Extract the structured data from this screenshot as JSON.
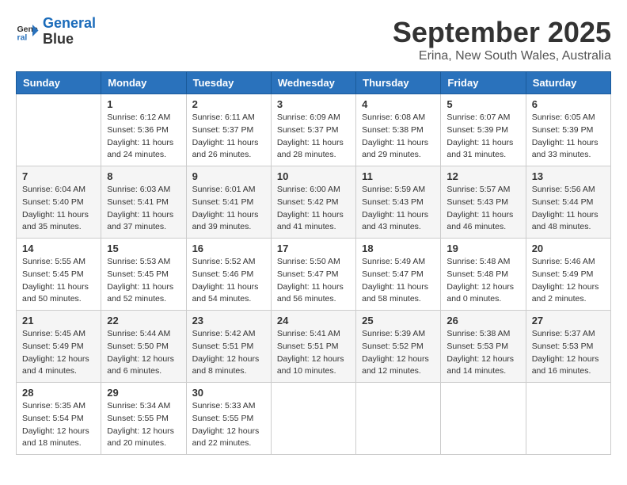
{
  "logo": {
    "line1": "General",
    "line2": "Blue"
  },
  "title": "September 2025",
  "location": "Erina, New South Wales, Australia",
  "days_header": [
    "Sunday",
    "Monday",
    "Tuesday",
    "Wednesday",
    "Thursday",
    "Friday",
    "Saturday"
  ],
  "weeks": [
    [
      {
        "day": "",
        "info": ""
      },
      {
        "day": "1",
        "info": "Sunrise: 6:12 AM\nSunset: 5:36 PM\nDaylight: 11 hours\nand 24 minutes."
      },
      {
        "day": "2",
        "info": "Sunrise: 6:11 AM\nSunset: 5:37 PM\nDaylight: 11 hours\nand 26 minutes."
      },
      {
        "day": "3",
        "info": "Sunrise: 6:09 AM\nSunset: 5:37 PM\nDaylight: 11 hours\nand 28 minutes."
      },
      {
        "day": "4",
        "info": "Sunrise: 6:08 AM\nSunset: 5:38 PM\nDaylight: 11 hours\nand 29 minutes."
      },
      {
        "day": "5",
        "info": "Sunrise: 6:07 AM\nSunset: 5:39 PM\nDaylight: 11 hours\nand 31 minutes."
      },
      {
        "day": "6",
        "info": "Sunrise: 6:05 AM\nSunset: 5:39 PM\nDaylight: 11 hours\nand 33 minutes."
      }
    ],
    [
      {
        "day": "7",
        "info": "Sunrise: 6:04 AM\nSunset: 5:40 PM\nDaylight: 11 hours\nand 35 minutes."
      },
      {
        "day": "8",
        "info": "Sunrise: 6:03 AM\nSunset: 5:41 PM\nDaylight: 11 hours\nand 37 minutes."
      },
      {
        "day": "9",
        "info": "Sunrise: 6:01 AM\nSunset: 5:41 PM\nDaylight: 11 hours\nand 39 minutes."
      },
      {
        "day": "10",
        "info": "Sunrise: 6:00 AM\nSunset: 5:42 PM\nDaylight: 11 hours\nand 41 minutes."
      },
      {
        "day": "11",
        "info": "Sunrise: 5:59 AM\nSunset: 5:43 PM\nDaylight: 11 hours\nand 43 minutes."
      },
      {
        "day": "12",
        "info": "Sunrise: 5:57 AM\nSunset: 5:43 PM\nDaylight: 11 hours\nand 46 minutes."
      },
      {
        "day": "13",
        "info": "Sunrise: 5:56 AM\nSunset: 5:44 PM\nDaylight: 11 hours\nand 48 minutes."
      }
    ],
    [
      {
        "day": "14",
        "info": "Sunrise: 5:55 AM\nSunset: 5:45 PM\nDaylight: 11 hours\nand 50 minutes."
      },
      {
        "day": "15",
        "info": "Sunrise: 5:53 AM\nSunset: 5:45 PM\nDaylight: 11 hours\nand 52 minutes."
      },
      {
        "day": "16",
        "info": "Sunrise: 5:52 AM\nSunset: 5:46 PM\nDaylight: 11 hours\nand 54 minutes."
      },
      {
        "day": "17",
        "info": "Sunrise: 5:50 AM\nSunset: 5:47 PM\nDaylight: 11 hours\nand 56 minutes."
      },
      {
        "day": "18",
        "info": "Sunrise: 5:49 AM\nSunset: 5:47 PM\nDaylight: 11 hours\nand 58 minutes."
      },
      {
        "day": "19",
        "info": "Sunrise: 5:48 AM\nSunset: 5:48 PM\nDaylight: 12 hours\nand 0 minutes."
      },
      {
        "day": "20",
        "info": "Sunrise: 5:46 AM\nSunset: 5:49 PM\nDaylight: 12 hours\nand 2 minutes."
      }
    ],
    [
      {
        "day": "21",
        "info": "Sunrise: 5:45 AM\nSunset: 5:49 PM\nDaylight: 12 hours\nand 4 minutes."
      },
      {
        "day": "22",
        "info": "Sunrise: 5:44 AM\nSunset: 5:50 PM\nDaylight: 12 hours\nand 6 minutes."
      },
      {
        "day": "23",
        "info": "Sunrise: 5:42 AM\nSunset: 5:51 PM\nDaylight: 12 hours\nand 8 minutes."
      },
      {
        "day": "24",
        "info": "Sunrise: 5:41 AM\nSunset: 5:51 PM\nDaylight: 12 hours\nand 10 minutes."
      },
      {
        "day": "25",
        "info": "Sunrise: 5:39 AM\nSunset: 5:52 PM\nDaylight: 12 hours\nand 12 minutes."
      },
      {
        "day": "26",
        "info": "Sunrise: 5:38 AM\nSunset: 5:53 PM\nDaylight: 12 hours\nand 14 minutes."
      },
      {
        "day": "27",
        "info": "Sunrise: 5:37 AM\nSunset: 5:53 PM\nDaylight: 12 hours\nand 16 minutes."
      }
    ],
    [
      {
        "day": "28",
        "info": "Sunrise: 5:35 AM\nSunset: 5:54 PM\nDaylight: 12 hours\nand 18 minutes."
      },
      {
        "day": "29",
        "info": "Sunrise: 5:34 AM\nSunset: 5:55 PM\nDaylight: 12 hours\nand 20 minutes."
      },
      {
        "day": "30",
        "info": "Sunrise: 5:33 AM\nSunset: 5:55 PM\nDaylight: 12 hours\nand 22 minutes."
      },
      {
        "day": "",
        "info": ""
      },
      {
        "day": "",
        "info": ""
      },
      {
        "day": "",
        "info": ""
      },
      {
        "day": "",
        "info": ""
      }
    ]
  ]
}
